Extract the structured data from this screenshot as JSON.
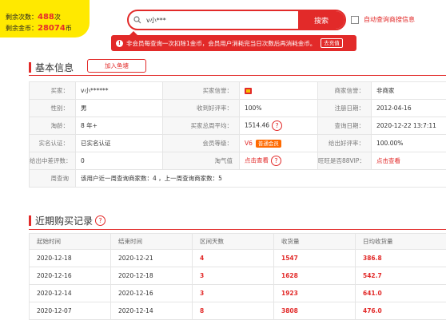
{
  "account": {
    "remaining_label": "剩余次数：",
    "remaining_value": "488",
    "remaining_unit": "次",
    "coins_label": "剩余金币：",
    "coins_value": "28074",
    "coins_unit": "币"
  },
  "search": {
    "value": "v小***",
    "button": "搜索"
  },
  "auto_query": {
    "label": "自动查询商搜信息",
    "checked": false
  },
  "notice": {
    "text": "非会员每查询一次扣除1金币，会员用户消耗完当日次数后再消耗金币。",
    "button": "去充值"
  },
  "basic": {
    "title": "基本信息",
    "add_button": "加入鱼塘",
    "rows": [
      [
        {
          "k": "买家：",
          "v": "v小******"
        },
        {
          "k": "买家信誉：",
          "v": "",
          "icon": "crown-icon"
        },
        {
          "k": "商家信誉：",
          "v": "非商家"
        }
      ],
      [
        {
          "k": "性别：",
          "v": "男"
        },
        {
          "k": "收到好评率：",
          "v": "100%"
        },
        {
          "k": "注册日期：",
          "v": "2012-04-16"
        }
      ],
      [
        {
          "k": "淘龄：",
          "v": "8 年+"
        },
        {
          "k": "买家总周平均：",
          "v": "1514.46",
          "help": true
        },
        {
          "k": "查询日期：",
          "v": "2020-12-22 13:7:11"
        }
      ],
      [
        {
          "k": "实名认证：",
          "v": "已实名认证"
        },
        {
          "k": "会员等级：",
          "v": "V6",
          "badge": "普通会员"
        },
        {
          "k": "给出好评率：",
          "v": "100.00%"
        }
      ],
      [
        {
          "k": "给出中差评数：",
          "v": "0"
        },
        {
          "k": "淘气值",
          "v": "点击查看",
          "help": true,
          "kred": true,
          "vred": true
        },
        {
          "k": "旺旺是否88VIP：",
          "v": "点击查看",
          "vred": true
        }
      ]
    ],
    "weekly": {
      "k": "周查询",
      "v": "该用户近一周查询商家数：4 ，上一周查询商家数：5"
    }
  },
  "recent": {
    "title": "近期购买记录",
    "headers": [
      "起始时间",
      "结束时间",
      "区间天数",
      "收货量",
      "日均收货量"
    ],
    "rows": [
      [
        "2020-12-18",
        "2020-12-21",
        "4",
        "1547",
        "386.8"
      ],
      [
        "2020-12-16",
        "2020-12-18",
        "3",
        "1628",
        "542.7"
      ],
      [
        "2020-12-14",
        "2020-12-16",
        "3",
        "1923",
        "641.0"
      ],
      [
        "2020-12-07",
        "2020-12-14",
        "8",
        "3808",
        "476.0"
      ]
    ]
  },
  "colors": {
    "accent": "#e22a29",
    "counter_bg": "#ffe900",
    "vip_badge": "#ff6a00"
  }
}
